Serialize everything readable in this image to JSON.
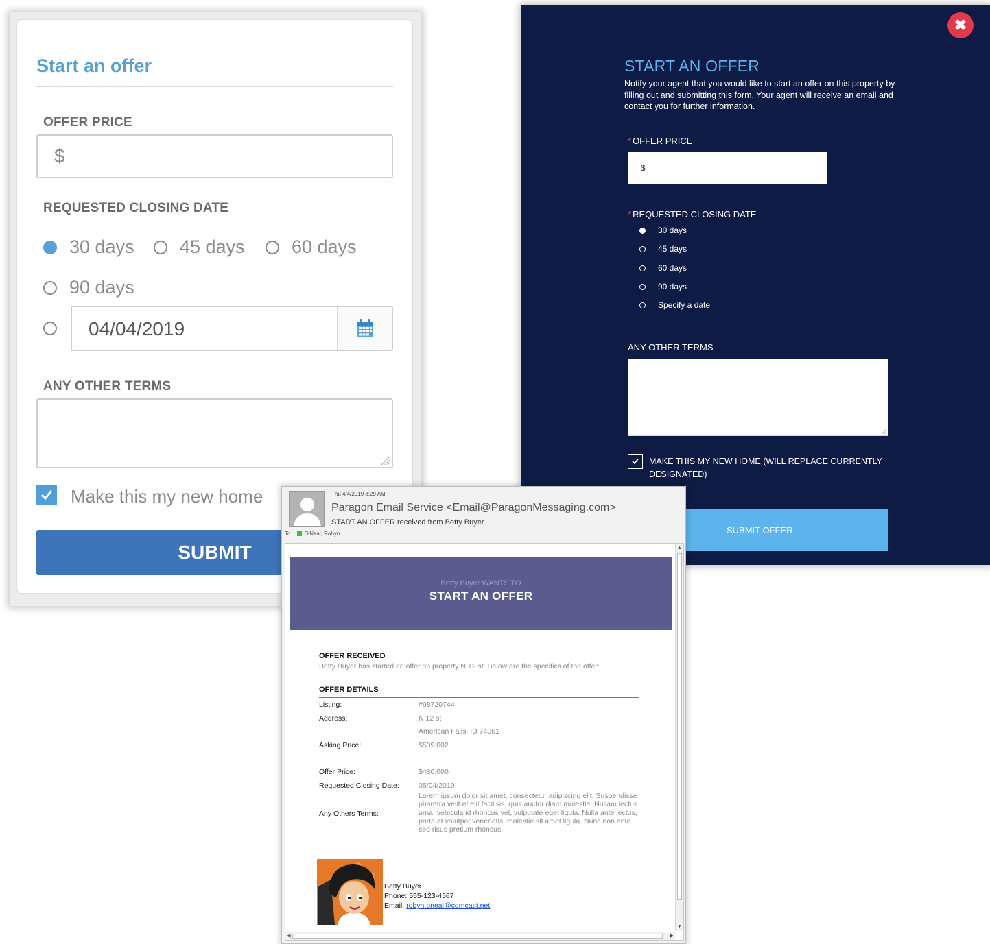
{
  "left_form": {
    "title": "Start an offer",
    "offer_price_label": "OFFER PRICE",
    "offer_price_prefix": "$",
    "closing_date_label": "REQUESTED CLOSING DATE",
    "closing_options": [
      "30 days",
      "45 days",
      "60 days",
      "90 days"
    ],
    "selected_option": "30 days",
    "date_value": "04/04/2019",
    "other_terms_label": "ANY OTHER TERMS",
    "new_home_label": "Make this my new home",
    "submit_label": "SUBMIT",
    "accent_color": "#5a9fcf",
    "submit_color": "#3e74b9"
  },
  "right_form": {
    "title": "START AN OFFER",
    "description": "Notify your agent that you would like to start an offer on this property by filling out and submitting this form. Your agent will receive an email and contact you for further information.",
    "required_mark": "*",
    "offer_price_label": "OFFER PRICE",
    "offer_price_prefix": "$",
    "closing_date_label": "REQUESTED CLOSING DATE",
    "closing_options": [
      "30 days",
      "45 days",
      "60 days",
      "90 days",
      "Specify a date"
    ],
    "selected_option": "30 days",
    "other_terms_label": "ANY OTHER TERMS",
    "new_home_label": "MAKE THIS MY NEW HOME (WILL REPLACE CURRENTLY DESIGNATED)",
    "submit_label": "SUBMIT OFFER",
    "background_color": "#0e1b44",
    "accent_color": "#5db4ec",
    "close_color": "#e23a4b",
    "close_icon": "close-icon"
  },
  "email": {
    "date": "Thu 4/4/2019 8:29 AM",
    "from": "Paragon Email Service <Email@ParagonMessaging.com>",
    "subject": "START AN OFFER received from Betty Buyer",
    "to_label": "To",
    "to_name": "O'Neal, Robyn L",
    "banner_sub": "Betty Buyer WANTS TO",
    "banner_title": "START AN OFFER",
    "banner_color": "#5b5b8f",
    "received_heading": "OFFER RECEIVED",
    "received_text": "Betty Buyer has started an offer on property N 12 st. Below are the specifics of the offer:",
    "details_heading": "OFFER DETAILS",
    "details": {
      "listing_label": "Listing:",
      "listing": "#98720744",
      "address_label": "Address:",
      "address_line1": "N 12 st",
      "address_line2": "American Falls, ID 74061",
      "asking_label": "Asking Price:",
      "asking": "$509,002",
      "offer_label": "Offer Price:",
      "offer": "$480,000",
      "closing_label": "Requested Closing Date:",
      "closing": "05/04/2019",
      "terms_label": "Any Others Terms:",
      "terms": "Lorem ipsum dolor sit amet, consectetur adipiscing elit. Suspendisse pharetra velit et elit facilisis, quis auctor diam molestie. Nullam lectus urna, vehicula id rhoncus vel, vulputate eget ligula. Nulla ante lectus, porta at volutpat venenatis, molestie sit amet ligula. Nunc non ante sed risus pretium rhoncus."
    },
    "signature": {
      "name": "Betty Buyer",
      "phone": "Phone: 555-123-4567",
      "email_label": "Email:",
      "email": "robyn.oneal@comcast.net"
    }
  }
}
